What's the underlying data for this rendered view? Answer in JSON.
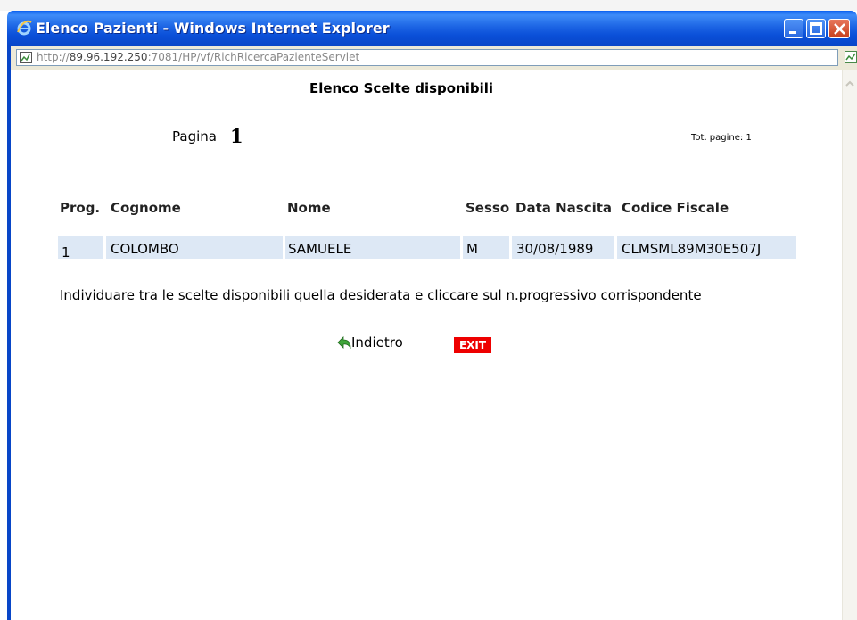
{
  "window": {
    "title": "Elenco Pazienti - Windows Internet Explorer",
    "url_prefix": "http://",
    "url_host": "89.96.192.250",
    "url_rest": ":7081/HP/vf/RichRicercaPazienteServlet",
    "title_color": "#0a4fd8",
    "icons": [
      "ie-logo-icon",
      "minimize-icon",
      "maximize-icon",
      "close-icon",
      "page-icon",
      "compat-view-icon",
      "scroll-up-icon"
    ]
  },
  "page": {
    "heading": "Elenco Scelte disponibili",
    "pagina_label": "Pagina",
    "pagina_number": "1",
    "tot_pagine": "Tot. pagine: 1"
  },
  "table": {
    "headers": [
      "Prog.",
      "Cognome",
      "Nome",
      "Sesso",
      "Data Nascita",
      "Codice Fiscale"
    ],
    "rows": [
      [
        "1",
        "COLOMBO",
        "SAMUELE",
        "M",
        "30/08/1989",
        "CLMSML89M30E507J"
      ]
    ],
    "row_color": "#dde8f5"
  },
  "instructions": "Individuare tra le scelte disponibili quella desiderata e cliccare sul n.progressivo corrispondente",
  "actions": {
    "back_label": "Indietro",
    "back_icon": "back-arrow-icon",
    "exit_label": "EXIT",
    "exit_color": "#ee0000"
  }
}
